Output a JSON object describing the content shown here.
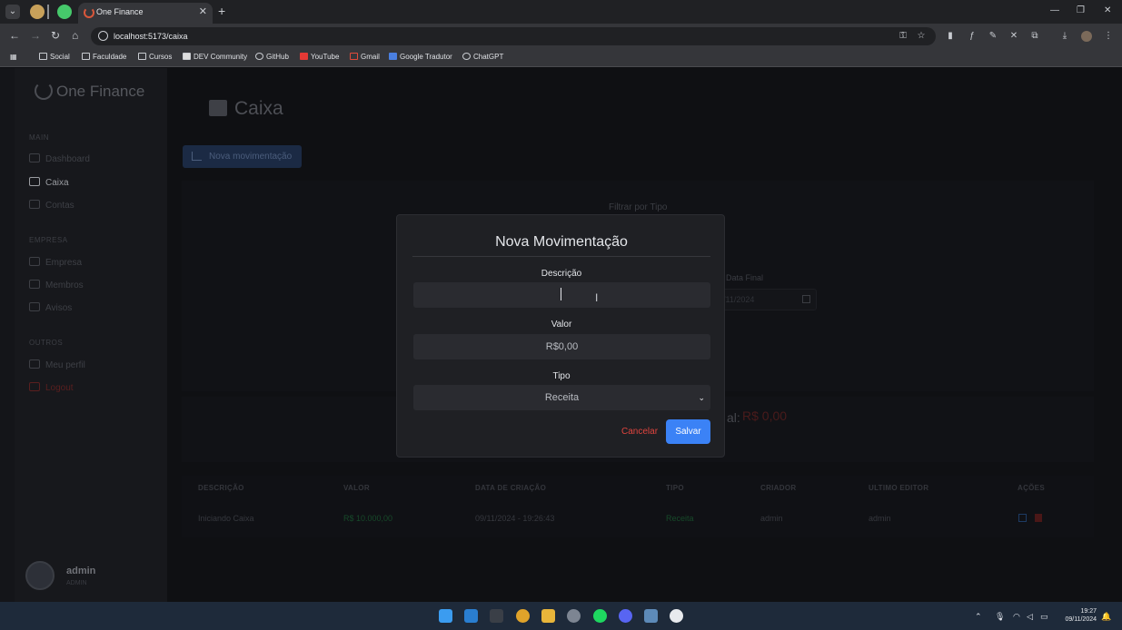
{
  "browser": {
    "tab_title": "One Finance",
    "url": "localhost:5173/caixa",
    "bookmarks": [
      "Social",
      "Faculdade",
      "Cursos",
      "DEV Community",
      "GitHub",
      "YouTube",
      "Gmail",
      "Google Tradutor",
      "ChatGPT"
    ]
  },
  "app": {
    "brand": "One Finance",
    "sidebar": {
      "sections": [
        "MAIN",
        "EMPRESA",
        "OUTROS"
      ],
      "items": [
        "Dashboard",
        "Caixa",
        "Contas",
        "Empresa",
        "Membros",
        "Avisos",
        "Meu perfil",
        "Logout"
      ],
      "user_name": "admin",
      "user_role": "ADMIN"
    },
    "page_title": "Caixa",
    "new_button": "Nova movimentação",
    "filter_label": "Filtrar por Tipo",
    "date_final_label": "Data Final",
    "date_final_value": "/11/2024",
    "total_label": "al:",
    "total_value": "R$ 0,00",
    "table": {
      "headers": [
        "DESCRIÇÃO",
        "VALOR",
        "DATA DE CRIAÇÃO",
        "TIPO",
        "CRIADOR",
        "ULTIMO EDITOR",
        "AÇÕES"
      ],
      "rows": [
        [
          "Iniciando Caixa",
          "R$ 10.000,00",
          "09/11/2024 - 19:26:43",
          "Receita",
          "admin",
          "admin"
        ]
      ]
    }
  },
  "modal": {
    "title": "Nova Movimentação",
    "descricao_label": "Descrição",
    "descricao_value": "",
    "valor_label": "Valor",
    "valor_placeholder": "R$0,00",
    "tipo_label": "Tipo",
    "tipo_selected": "Receita",
    "cancel_label": "Cancelar",
    "save_label": "Salvar"
  },
  "taskbar": {
    "time": "19:27",
    "date": "09/11/2024"
  }
}
